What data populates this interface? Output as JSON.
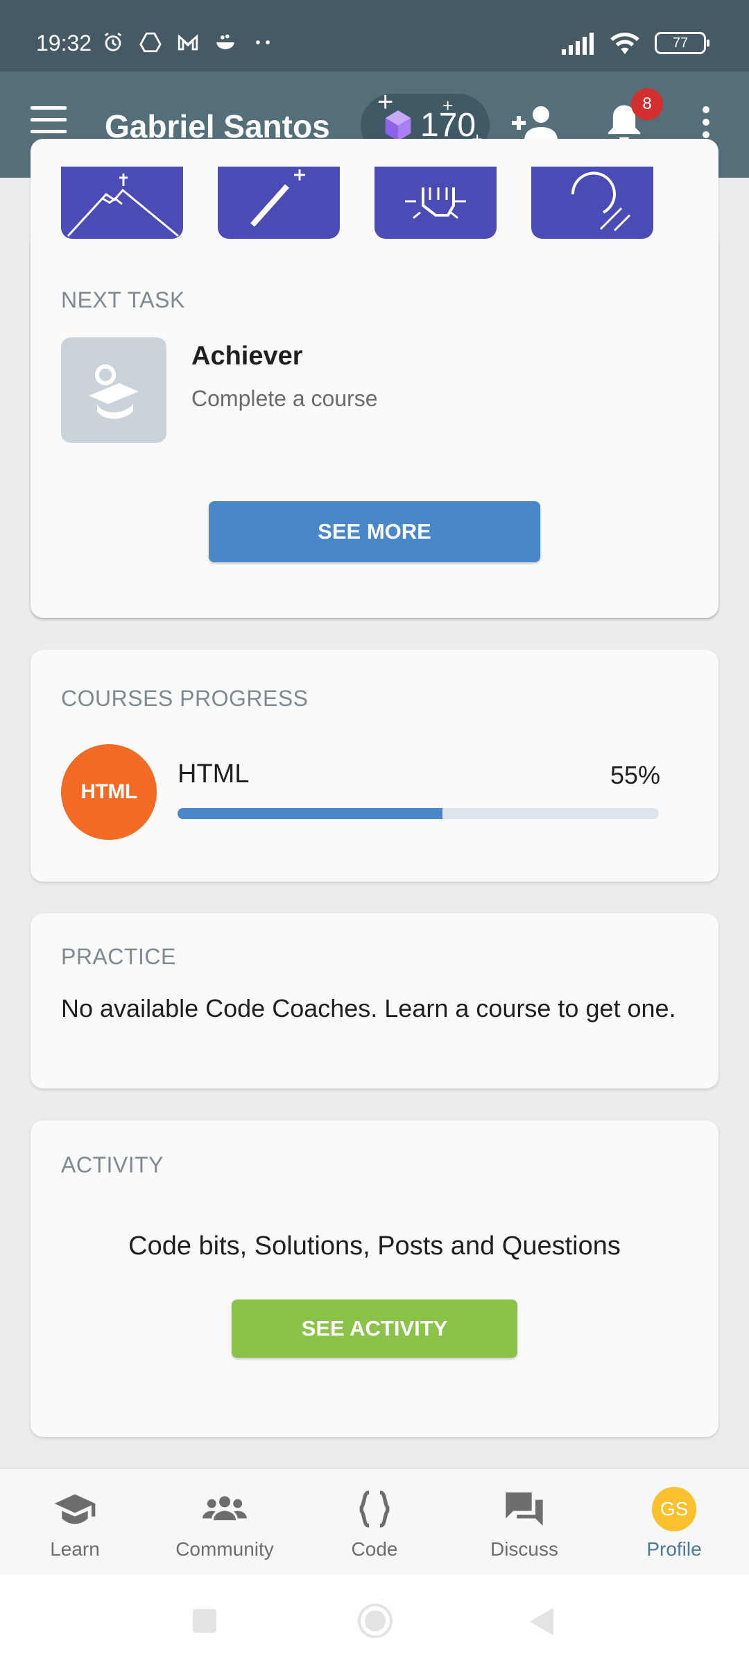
{
  "status_bar": {
    "time": "19:32",
    "battery": "77",
    "left_icons": [
      "alarm-icon",
      "drive-icon",
      "gmail-icon",
      "bowl-icon",
      "more-dots-icon"
    ],
    "right_icons": [
      "signal-icon",
      "wifi-icon",
      "battery-icon"
    ]
  },
  "app_bar": {
    "title": "Gabriel Santos",
    "xp": "170",
    "notification_count": "8",
    "icons": [
      "menu-icon",
      "xp-cube-icon",
      "add-friend-icon",
      "bell-icon",
      "more-vert-icon"
    ]
  },
  "achievements": {
    "badge_icons": [
      "mountain-icon",
      "wand-icon",
      "hand-icon",
      "ear-icon"
    ],
    "badge_color": "#4b4bb5"
  },
  "next_task": {
    "label": "NEXT TASK",
    "title": "Achiever",
    "subtitle": "Complete a course",
    "icon": "graduation-cap-icon",
    "button": "SEE MORE"
  },
  "courses": {
    "label": "COURSES PROGRESS",
    "items": [
      {
        "logo": "HTML",
        "name": "HTML",
        "percent_label": "55%",
        "progress": 0.55
      }
    ]
  },
  "practice": {
    "label": "PRACTICE",
    "text": "No available Code Coaches. Learn a course to get one."
  },
  "activity": {
    "label": "ACTIVITY",
    "text": "Code bits, Solutions, Posts and Questions",
    "button": "SEE ACTIVITY"
  },
  "bottom_nav": {
    "items": [
      {
        "label": "Learn",
        "icon": "graduation-cap-icon"
      },
      {
        "label": "Community",
        "icon": "group-icon"
      },
      {
        "label": "Code",
        "icon": "braces-icon"
      },
      {
        "label": "Discuss",
        "icon": "chat-icon"
      },
      {
        "label": "Profile",
        "icon": "avatar",
        "avatar_initials": "GS",
        "active": true
      }
    ]
  },
  "colors": {
    "status_bar": "#455a64",
    "app_bar": "#546e7a",
    "primary_button": "#4a87c8",
    "activity_button": "#8bc34a",
    "html_logo": "#f26a23",
    "badge_red": "#d32f2f",
    "avatar": "#fbc02d"
  }
}
